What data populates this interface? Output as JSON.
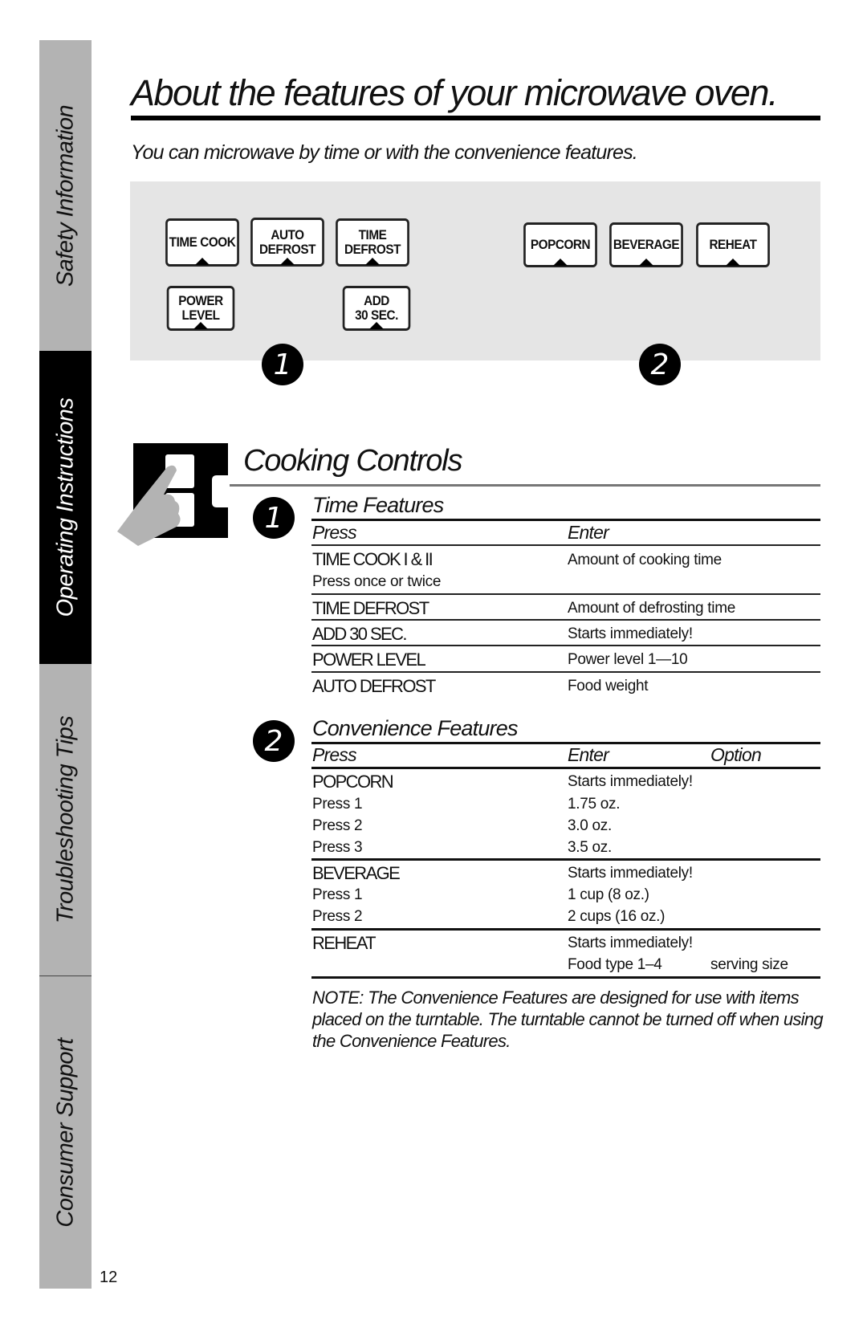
{
  "sidebar": {
    "tabs": [
      {
        "label": "Safety Information",
        "active": false
      },
      {
        "label": "Operating Instructions",
        "active": true
      },
      {
        "label": "Troubleshooting Tips",
        "active": false
      },
      {
        "label": "Consumer Support",
        "active": false
      }
    ]
  },
  "page_number": "12",
  "header": {
    "title": "About the features of your microwave oven.",
    "subtitle": "You can microwave by time or with the convenience features."
  },
  "control_panel": {
    "group1_keys": [
      {
        "line1": "TIME COOK",
        "line2": ""
      },
      {
        "line1": "AUTO",
        "line2": "DEFROST"
      },
      {
        "line1": "TIME",
        "line2": "DEFROST"
      },
      {
        "line1": "POWER",
        "line2": "LEVEL"
      },
      {
        "line1": "ADD",
        "line2": "30 SEC."
      }
    ],
    "group2_keys": [
      {
        "line1": "POPCORN"
      },
      {
        "line1": "BEVERAGE"
      },
      {
        "line1": "REHEAT"
      }
    ],
    "badges": [
      "1",
      "2"
    ]
  },
  "cooking_controls": {
    "title": "Cooking Controls",
    "time_features": {
      "badge": "1",
      "title": "Time Features",
      "headers": {
        "press": "Press",
        "enter": "Enter"
      },
      "rows": [
        {
          "press": "TIME COOK I & II",
          "enter": "Amount of cooking time",
          "sub": "Press once or twice"
        },
        {
          "press": "TIME DEFROST",
          "enter": "Amount of defrosting time"
        },
        {
          "press": "ADD 30 SEC.",
          "enter": "Starts immediately!"
        },
        {
          "press": "POWER LEVEL",
          "enter": "Power level 1—10"
        },
        {
          "press": "AUTO DEFROST",
          "enter": "Food weight"
        }
      ]
    },
    "convenience_features": {
      "badge": "2",
      "title": "Convenience Features",
      "headers": {
        "press": "Press",
        "enter": "Enter",
        "option": "Option"
      },
      "groups": [
        {
          "press": "POPCORN",
          "enter": "Starts immediately!",
          "rows": [
            {
              "press": "Press 1",
              "enter": "1.75 oz."
            },
            {
              "press": "Press 2",
              "enter": "3.0 oz."
            },
            {
              "press": "Press 3",
              "enter": "3.5 oz."
            }
          ]
        },
        {
          "press": "BEVERAGE",
          "enter": "Starts immediately!",
          "rows": [
            {
              "press": "Press 1",
              "enter": "1 cup (8 oz.)"
            },
            {
              "press": "Press 2",
              "enter": "2 cups (16 oz.)"
            }
          ]
        },
        {
          "press": "REHEAT",
          "enter": "Starts immediately!",
          "rows": [
            {
              "press": "",
              "enter": "Food type 1–4",
              "option": "serving size"
            }
          ]
        }
      ]
    },
    "note": "NOTE: The Convenience Features are designed for use with items placed on the turntable. The turntable cannot be turned off when using the Convenience Features."
  }
}
